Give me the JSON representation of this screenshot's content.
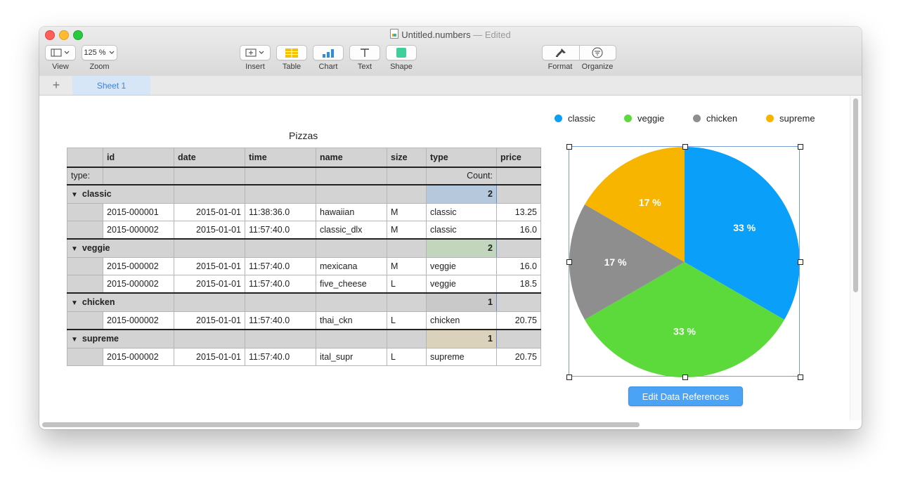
{
  "window": {
    "title": "Untitled.numbers",
    "status": "— Edited"
  },
  "toolbar": {
    "view_label": "View",
    "zoom_value": "125 %",
    "zoom_label": "Zoom",
    "insert_label": "Insert",
    "table_label": "Table",
    "chart_label": "Chart",
    "text_label": "Text",
    "shape_label": "Shape",
    "format_label": "Format",
    "organize_label": "Organize"
  },
  "tabs": {
    "add_label": "+",
    "sheet_label": "Sheet 1"
  },
  "table": {
    "title": "Pizzas",
    "columns": [
      "id",
      "date",
      "time",
      "name",
      "size",
      "type",
      "price"
    ],
    "category_label": "type:",
    "count_label": "Count:",
    "groups": [
      {
        "name": "classic",
        "count": "2",
        "rows": [
          [
            "2015-000001",
            "2015-01-01",
            "11:38:36.0",
            "hawaiian",
            "M",
            "classic",
            "13.25"
          ],
          [
            "2015-000002",
            "2015-01-01",
            "11:57:40.0",
            "classic_dlx",
            "M",
            "classic",
            "16.0"
          ]
        ]
      },
      {
        "name": "veggie",
        "count": "2",
        "rows": [
          [
            "2015-000002",
            "2015-01-01",
            "11:57:40.0",
            "mexicana",
            "M",
            "veggie",
            "16.0"
          ],
          [
            "2015-000002",
            "2015-01-01",
            "11:57:40.0",
            "five_cheese",
            "L",
            "veggie",
            "18.5"
          ]
        ]
      },
      {
        "name": "chicken",
        "count": "1",
        "rows": [
          [
            "2015-000002",
            "2015-01-01",
            "11:57:40.0",
            "thai_ckn",
            "L",
            "chicken",
            "20.75"
          ]
        ]
      },
      {
        "name": "supreme",
        "count": "1",
        "rows": [
          [
            "2015-000002",
            "2015-01-01",
            "11:57:40.0",
            "ital_supr",
            "L",
            "supreme",
            "20.75"
          ]
        ]
      }
    ]
  },
  "chart_data": {
    "type": "pie",
    "categories": [
      "classic",
      "veggie",
      "chicken",
      "supreme"
    ],
    "values": [
      2,
      2,
      1,
      1
    ],
    "labels": [
      "33 %",
      "33 %",
      "17 %",
      "17 %"
    ],
    "colors": [
      "#0aa0fa",
      "#5cd93b",
      "#8e8e8e",
      "#f7b500"
    ],
    "legend_position": "top"
  },
  "edit_button_label": "Edit Data References",
  "group_count_colors": [
    "#b6c8dc",
    "#c2d5bd",
    "#c9c9c9",
    "#dad2bb"
  ]
}
